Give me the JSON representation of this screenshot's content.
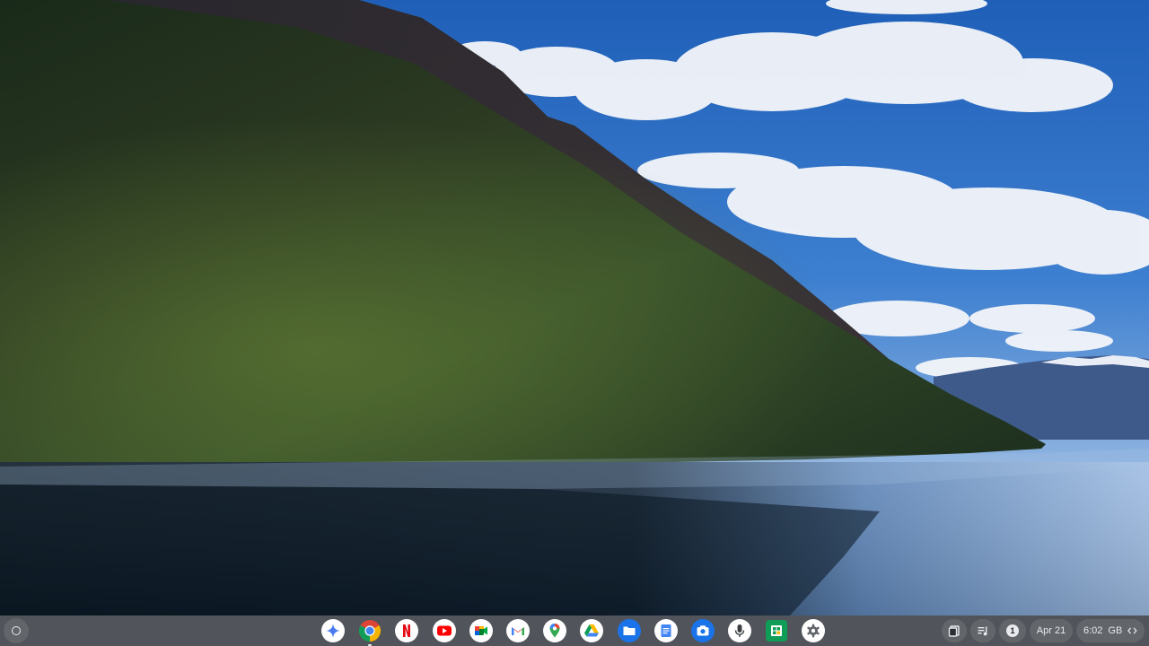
{
  "desktop": {
    "wallpaper": "lake-and-mountain-landscape",
    "colors": {
      "sky": "#2f6fc4",
      "mountain": "#1f3320",
      "water": "#162838",
      "shelf": "#20242c"
    }
  },
  "shelf": {
    "launcher_icon": "launcher-circle-icon",
    "apps": [
      {
        "name": "Gemini",
        "icon": "gemini-icon",
        "running": false
      },
      {
        "name": "Chrome",
        "icon": "chrome-icon",
        "running": true
      },
      {
        "name": "Netflix",
        "icon": "netflix-icon",
        "running": false
      },
      {
        "name": "YouTube",
        "icon": "youtube-icon",
        "running": false
      },
      {
        "name": "Google Meet",
        "icon": "meet-icon",
        "running": false
      },
      {
        "name": "Gmail",
        "icon": "gmail-icon",
        "running": false
      },
      {
        "name": "Google Maps",
        "icon": "maps-icon",
        "running": false
      },
      {
        "name": "Google Drive",
        "icon": "drive-icon",
        "running": false
      },
      {
        "name": "Files",
        "icon": "files-icon",
        "running": false
      },
      {
        "name": "Google Docs",
        "icon": "docs-icon",
        "running": false
      },
      {
        "name": "Camera",
        "icon": "camera-icon",
        "running": false
      },
      {
        "name": "Recorder",
        "icon": "recorder-icon",
        "running": false
      },
      {
        "name": "Google Sheets",
        "icon": "sheets-icon",
        "running": false
      },
      {
        "name": "Settings",
        "icon": "settings-gear-icon",
        "running": false
      }
    ],
    "tray": {
      "clipboard_icon": "clipboard-icon",
      "media_icon": "media-controls-icon",
      "notification_count": "1",
      "date": "Apr 21",
      "time": "6:02",
      "ime": "GB",
      "network_icon": "ethernet-icon"
    }
  }
}
